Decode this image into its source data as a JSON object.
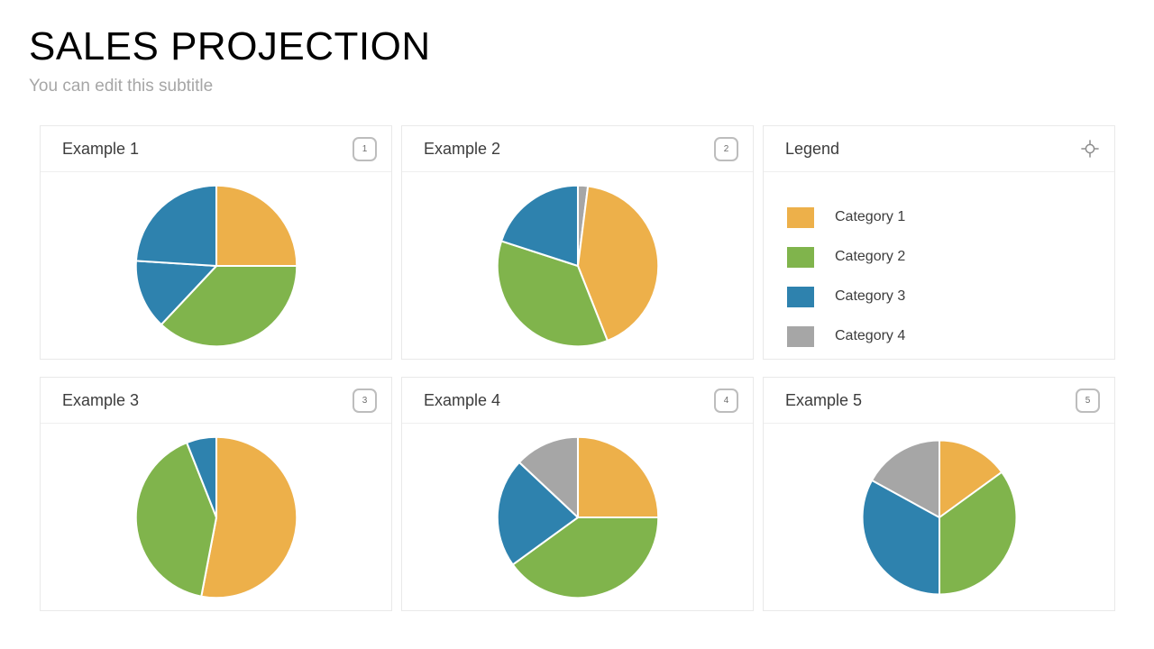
{
  "header": {
    "title": "SALES PROJECTION",
    "subtitle": "You can edit this subtitle"
  },
  "colors": {
    "category_1": "#edb04a",
    "category_2": "#80b44c",
    "category_3": "#2e82ae",
    "category_4": "#a6a6a6",
    "card_border": "#e9e9e9",
    "divider": "#efefef",
    "title_text": "#000000",
    "subtitle_text": "#a6a6a6",
    "badge_border": "#bdbdbd"
  },
  "legend": {
    "title": "Legend",
    "icon": "crosshair-icon",
    "items": [
      {
        "label": "Category 1",
        "color": "#edb04a"
      },
      {
        "label": "Category 2",
        "color": "#80b44c"
      },
      {
        "label": "Category 3",
        "color": "#2e82ae"
      },
      {
        "label": "Category 4",
        "color": "#a6a6a6"
      }
    ]
  },
  "cards": [
    {
      "title": "Example 1",
      "badge": "1"
    },
    {
      "title": "Example 2",
      "badge": "2"
    },
    {
      "title": "Example 3",
      "badge": "3"
    },
    {
      "title": "Example 4",
      "badge": "4"
    },
    {
      "title": "Example 5",
      "badge": "5"
    }
  ],
  "chart_data": [
    {
      "type": "pie",
      "title": "Example 1",
      "labels": [
        "Category 1",
        "Category 2",
        "Category 3",
        "Category 3"
      ],
      "values": [
        25,
        37,
        14,
        24
      ],
      "colors": [
        "#edb04a",
        "#80b44c",
        "#2e82ae",
        "#2e82ae"
      ],
      "start_angle": 0,
      "legend": "shared"
    },
    {
      "type": "pie",
      "title": "Example 2",
      "labels": [
        "Category 4",
        "Category 1",
        "Category 2",
        "Category 3"
      ],
      "values": [
        2,
        42,
        36,
        20
      ],
      "colors": [
        "#a6a6a6",
        "#edb04a",
        "#80b44c",
        "#2e82ae"
      ],
      "start_angle": 0,
      "legend": "shared"
    },
    {
      "type": "pie",
      "title": "Example 3",
      "labels": [
        "Category 1",
        "Category 2",
        "Category 3"
      ],
      "values": [
        53,
        41,
        6
      ],
      "colors": [
        "#edb04a",
        "#80b44c",
        "#2e82ae"
      ],
      "start_angle": 0,
      "legend": "shared"
    },
    {
      "type": "pie",
      "title": "Example 4",
      "labels": [
        "Category 1",
        "Category 2",
        "Category 3",
        "Category 4"
      ],
      "values": [
        25,
        40,
        22,
        13
      ],
      "colors": [
        "#edb04a",
        "#80b44c",
        "#2e82ae",
        "#a6a6a6"
      ],
      "start_angle": 0,
      "legend": "shared"
    },
    {
      "type": "pie",
      "title": "Example 5",
      "labels": [
        "Category 1",
        "Category 2",
        "Category 3",
        "Category 4"
      ],
      "values": [
        15,
        35,
        33,
        17
      ],
      "colors": [
        "#edb04a",
        "#80b44c",
        "#2e82ae",
        "#a6a6a6"
      ],
      "start_angle": 0,
      "legend": "shared"
    }
  ]
}
